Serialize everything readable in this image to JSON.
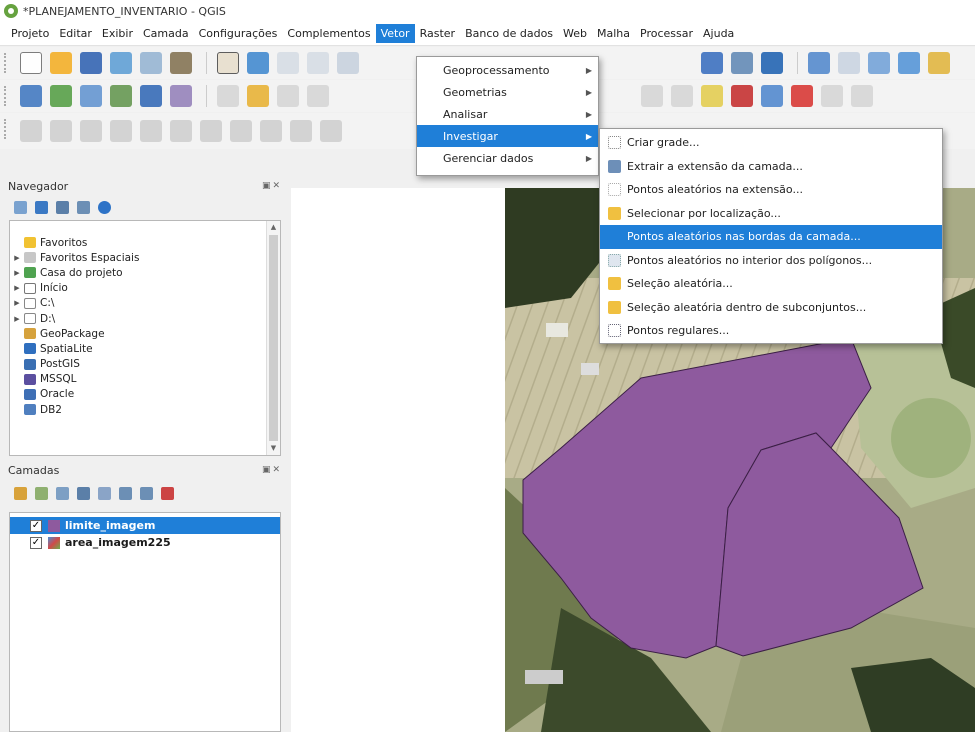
{
  "window": {
    "title": "*PLANEJAMENTO_INVENTARIO - QGIS"
  },
  "menubar": [
    "Projeto",
    "Editar",
    "Exibir",
    "Camada",
    "Configurações",
    "Complementos",
    "Vetor",
    "Raster",
    "Banco de dados",
    "Web",
    "Malha",
    "Processar",
    "Ajuda"
  ],
  "vector_menu": {
    "items": [
      "Geoprocessamento",
      "Geometrias",
      "Analisar",
      "Investigar",
      "Gerenciar dados"
    ],
    "highlighted": "Investigar"
  },
  "investigar_submenu": {
    "items": [
      {
        "label": "Criar grade...",
        "icon": "grid-icon"
      },
      {
        "label": "Extrair a extensão da camada...",
        "icon": "extent-icon"
      },
      {
        "label": "Pontos aleatórios na extensão...",
        "icon": "random-points-extent-icon"
      },
      {
        "label": "Selecionar por localização...",
        "icon": "select-location-icon"
      },
      {
        "label": "Pontos aleatórios nas bordas da camada...",
        "icon": "random-points-border-icon"
      },
      {
        "label": "Pontos aleatórios no interior dos polígonos...",
        "icon": "random-points-polygon-icon"
      },
      {
        "label": "Seleção aleatória...",
        "icon": "random-selection-icon"
      },
      {
        "label": "Seleção aleatória dentro de subconjuntos...",
        "icon": "random-subset-icon"
      },
      {
        "label": "Pontos regulares...",
        "icon": "regular-points-icon"
      }
    ],
    "highlighted": "Pontos aleatórios nas bordas da camada..."
  },
  "browser_panel": {
    "title": "Navegador",
    "items": [
      {
        "label": "Favoritos",
        "icon": "star-icon",
        "expandable": false
      },
      {
        "label": "Favoritos Espaciais",
        "icon": "spatial-bookmarks-icon",
        "expandable": true
      },
      {
        "label": "Casa do projeto",
        "icon": "project-home-icon",
        "expandable": true
      },
      {
        "label": "Início",
        "icon": "home-folder-icon",
        "expandable": true
      },
      {
        "label": "C:\\",
        "icon": "drive-icon",
        "expandable": true
      },
      {
        "label": "D:\\",
        "icon": "drive-icon",
        "expandable": true
      },
      {
        "label": "GeoPackage",
        "icon": "geopackage-icon",
        "expandable": false
      },
      {
        "label": "SpatiaLite",
        "icon": "spatialite-icon",
        "expandable": false
      },
      {
        "label": "PostGIS",
        "icon": "postgis-icon",
        "expandable": false
      },
      {
        "label": "MSSQL",
        "icon": "mssql-icon",
        "expandable": false
      },
      {
        "label": "Oracle",
        "icon": "oracle-icon",
        "expandable": false
      },
      {
        "label": "DB2",
        "icon": "db2-icon",
        "expandable": false
      }
    ]
  },
  "layers_panel": {
    "title": "Camadas",
    "layers": [
      {
        "name": "limite_imagem",
        "checked": true,
        "selected": true
      },
      {
        "name": "area_imagem225",
        "checked": true,
        "selected": false
      }
    ]
  },
  "colors": {
    "accent": "#1f7fd8",
    "polygon": "#8e5a9e"
  }
}
